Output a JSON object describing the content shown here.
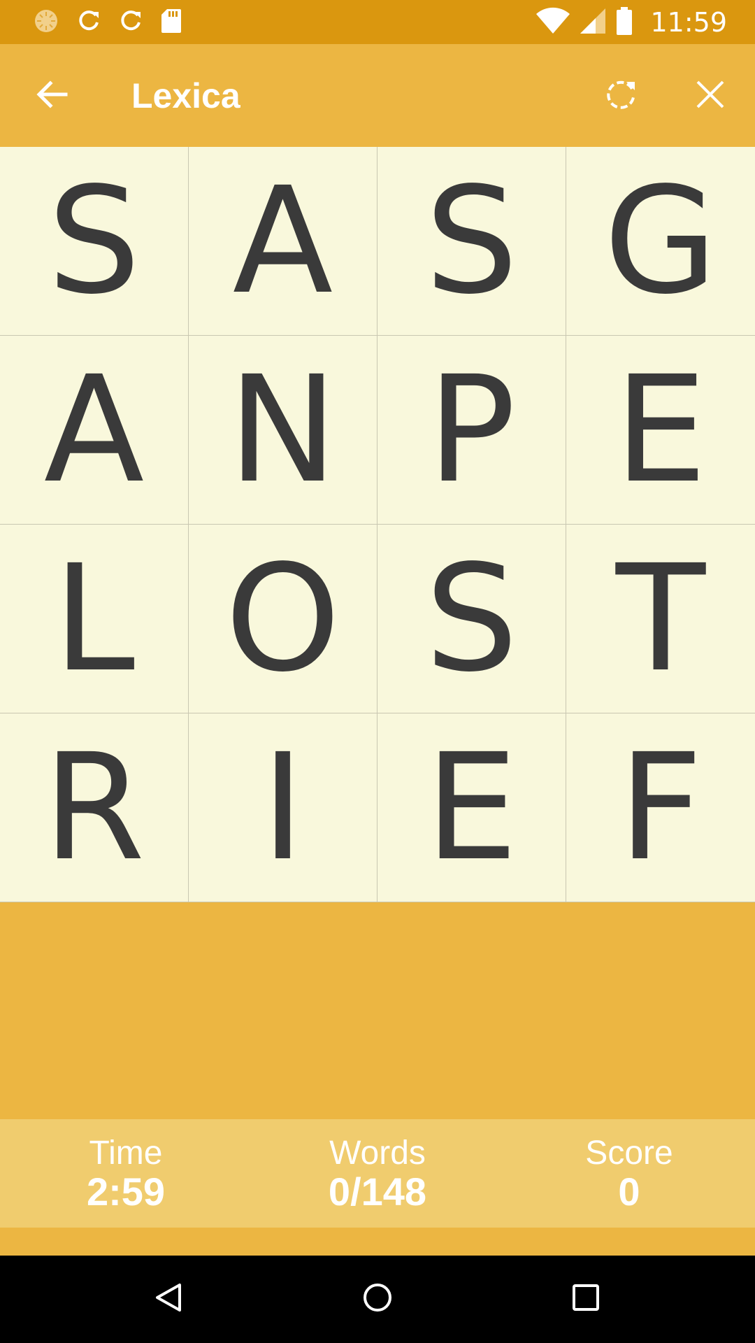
{
  "status_bar": {
    "time": "11:59",
    "left_icons": [
      "sync-spinner-icon",
      "refresh-icon",
      "refresh-icon",
      "sd-card-icon"
    ],
    "right_icons": [
      "wifi-icon",
      "cell-signal-icon",
      "battery-icon"
    ]
  },
  "app_bar": {
    "title": "Lexica",
    "back_icon": "arrow-left-icon",
    "rotate_icon": "rotate-board-icon",
    "close_icon": "close-icon"
  },
  "board": {
    "rows": [
      [
        "S",
        "A",
        "S",
        "G"
      ],
      [
        "A",
        "N",
        "P",
        "E"
      ],
      [
        "L",
        "O",
        "S",
        "T"
      ],
      [
        "R",
        "I",
        "E",
        "F"
      ]
    ]
  },
  "stats": {
    "time_label": "Time",
    "time_value": "2:59",
    "words_label": "Words",
    "words_value": "0/148",
    "score_label": "Score",
    "score_value": "0"
  },
  "nav_bar": {
    "icons": [
      "back-triangle-icon",
      "home-circle-icon",
      "recents-square-icon"
    ]
  },
  "colors": {
    "status_bar": "#DA970F",
    "app_bar": "#ECB642",
    "tile_bg": "#F9F8DC",
    "tile_letter": "#3A3A3A",
    "stats_bg": "#F0CC6E",
    "nav_bar": "#000000"
  }
}
